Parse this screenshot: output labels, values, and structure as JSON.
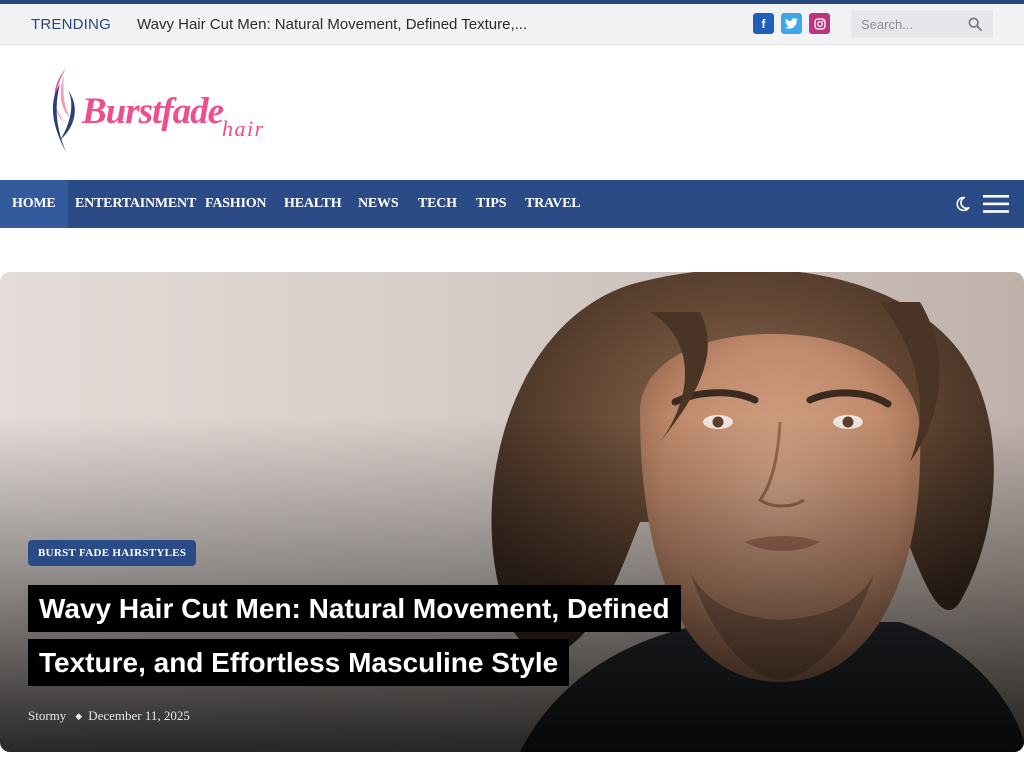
{
  "topbar": {
    "trending_label": "TRENDING",
    "trending_headline": "Wavy Hair Cut Men: Natural Movement, Defined Texture,...",
    "social": [
      {
        "name": "facebook",
        "glyph": "f",
        "color": "#1f5fb8"
      },
      {
        "name": "twitter",
        "color": "#3fa7e8"
      },
      {
        "name": "instagram",
        "color": "#b8367f"
      }
    ],
    "search": {
      "placeholder": "Search...",
      "value": ""
    }
  },
  "logo": {
    "wordmark": "Burstfade",
    "sub": "hair"
  },
  "nav": {
    "items": [
      {
        "label": "HOME",
        "active": true
      },
      {
        "label": "ENTERTAINMENT",
        "active": false
      },
      {
        "label": "FASHION",
        "active": false
      },
      {
        "label": "HEALTH",
        "active": false
      },
      {
        "label": "NEWS",
        "active": false
      },
      {
        "label": "TECH",
        "active": false
      },
      {
        "label": "TIPS",
        "active": false
      },
      {
        "label": "TRAVEL",
        "active": false
      }
    ],
    "color": "#2b4b86"
  },
  "hero": {
    "category": "BURST FADE HAIRSTYLES",
    "title": "Wavy Hair Cut Men: Natural Movement, Defined Texture, and Effortless Masculine Style",
    "author": "Stormy",
    "date": "December 11, 2025"
  },
  "colors": {
    "accent": "#27487c",
    "nav": "#2b4b86",
    "facebook": "#1f5fb8",
    "twitter": "#3fa7e8",
    "instagram": "#b8367f"
  }
}
